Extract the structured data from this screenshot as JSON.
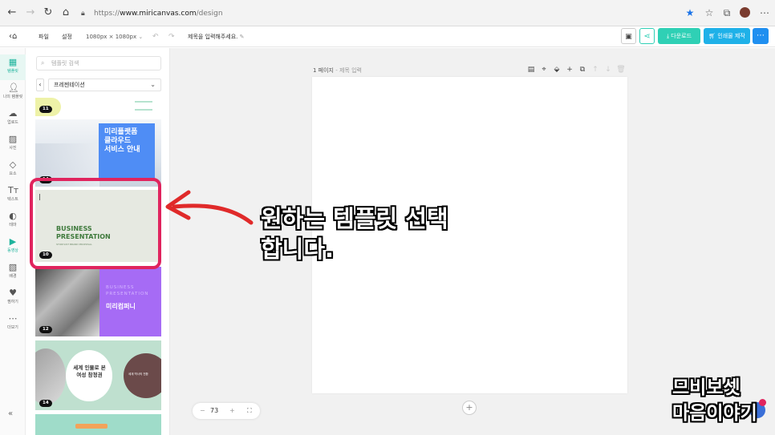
{
  "browser": {
    "url": "https://www.miricanvas.com/design",
    "url_prefix": "https://",
    "url_domain": "www.miricanvas.com",
    "url_path": "/design"
  },
  "toolbar": {
    "menu_file": "파일",
    "menu_settings": "설정",
    "size": "1080px × 1080px",
    "title_placeholder": "제목을 입력해주세요.",
    "download_label": "다운로드",
    "print_label": "인쇄물 제작",
    "colors": {
      "download_bg": "#2fd0b5",
      "print_bg": "#1fb1e8",
      "share_bg": "#2fd0b5",
      "more_bg": "#1f8ff0"
    }
  },
  "rail": {
    "items": [
      {
        "label": "템플릿",
        "icon": "template-icon",
        "active": true
      },
      {
        "label": "나의 템플릿",
        "icon": "user-icon",
        "active": false
      },
      {
        "label": "업로드",
        "icon": "upload-cloud-icon",
        "active": false
      },
      {
        "label": "사진",
        "icon": "photo-icon",
        "active": false
      },
      {
        "label": "요소",
        "icon": "elements-icon",
        "active": false
      },
      {
        "label": "텍스트",
        "icon": "text-icon",
        "active": false
      },
      {
        "label": "테마",
        "icon": "palette-icon",
        "active": false
      },
      {
        "label": "동영상",
        "icon": "play-icon",
        "active": false
      },
      {
        "label": "배경",
        "icon": "background-icon",
        "active": false
      },
      {
        "label": "찜하기",
        "icon": "heart-icon",
        "active": false
      },
      {
        "label": "더보기",
        "icon": "more-dots-icon",
        "active": false
      }
    ],
    "accent": "#1db39c"
  },
  "panel": {
    "search_placeholder": "템플릿 검색",
    "filter_value": "프레젠테이션",
    "templates": [
      {
        "count": "11"
      },
      {
        "count": "14",
        "heading": "미리플랫폼\n클라우드\n서비스 안내"
      },
      {
        "count": "10",
        "heading": "BUSINESS\nPRESENTATION",
        "sub": "STORYLIST BRAND PROPOSAL"
      },
      {
        "count": "12",
        "heading_en": "BUSINESS\nPRESENTATION",
        "heading_ko": "미리컴퍼니"
      },
      {
        "count": "14",
        "heading": "세계 인물로 본\n여성 참정권",
        "circle_text": "세계 역사의 전환"
      }
    ]
  },
  "canvas": {
    "page_label": "1 페이지",
    "page_sub": " - 제목 입력",
    "zoom": "73"
  },
  "annotation": {
    "line1": "원하는 템플릿 선택",
    "line2": "합니다.",
    "highlight_color": "#e0245e"
  },
  "watermark": {
    "line1": "므비보셋",
    "line2": "마음이야기"
  }
}
